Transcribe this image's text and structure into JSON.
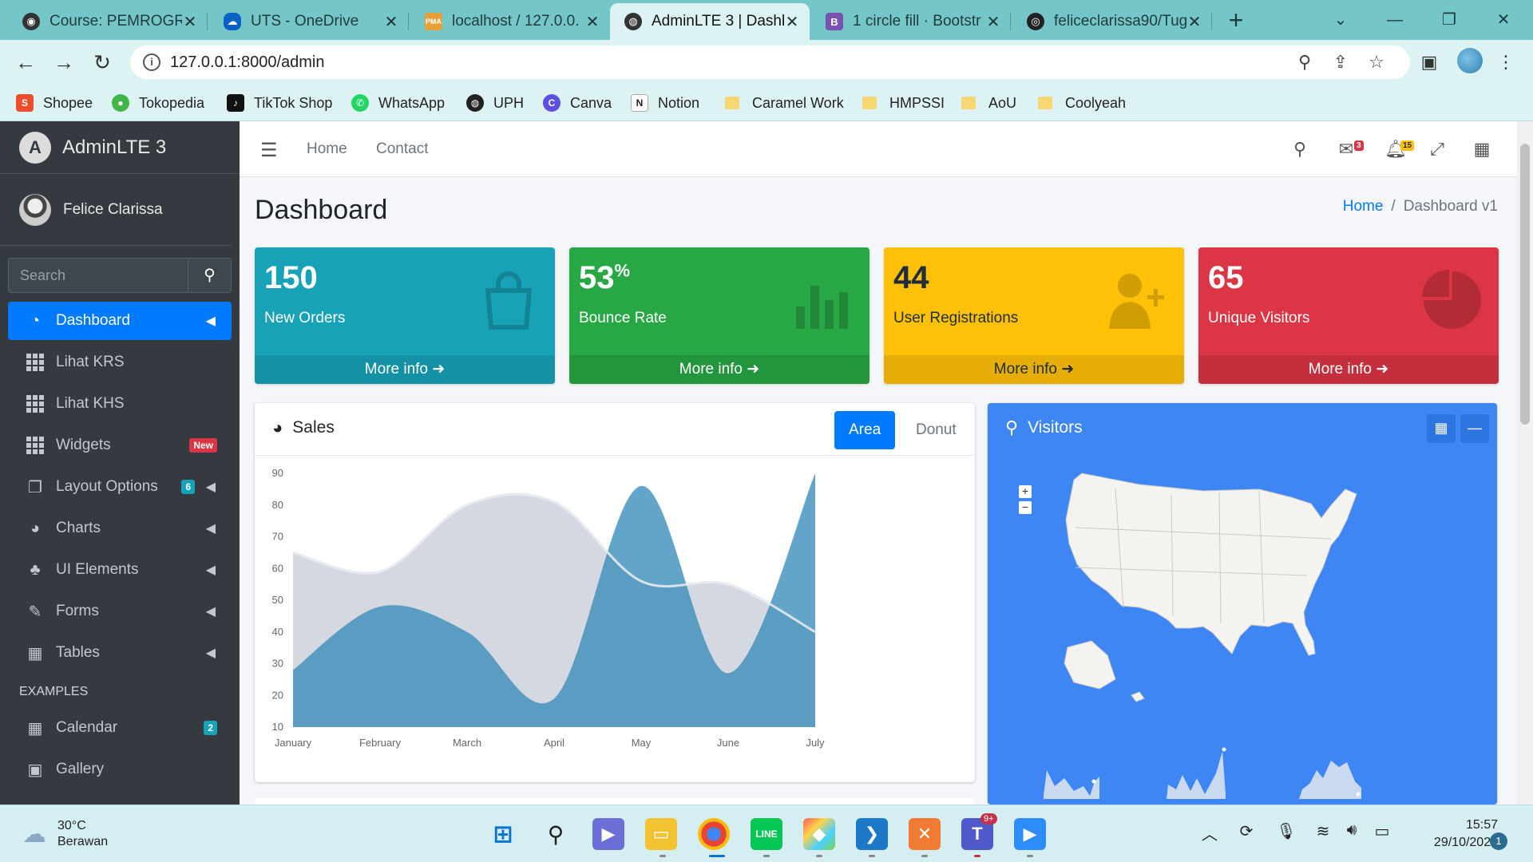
{
  "browser": {
    "tabs": [
      {
        "title": "Course: PEMROGRA",
        "icon": "moodle-icon",
        "active": false
      },
      {
        "title": "UTS - OneDrive",
        "icon": "onedrive-icon",
        "active": false
      },
      {
        "title": "localhost / 127.0.0.",
        "icon": "phpmyadmin-icon",
        "active": false
      },
      {
        "title": "AdminLTE 3 | Dashb",
        "icon": "globe-icon",
        "active": true
      },
      {
        "title": "1 circle fill · Bootstr",
        "icon": "bootstrap-icon",
        "active": false
      },
      {
        "title": "feliceclarissa90/Tug",
        "icon": "github-icon",
        "active": false
      }
    ],
    "url": "127.0.0.1:8000/admin",
    "bookmarks": [
      {
        "label": "Shopee",
        "icon": "shopee-icon"
      },
      {
        "label": "Tokopedia",
        "icon": "tokopedia-icon"
      },
      {
        "label": "TikTok Shop",
        "icon": "tiktok-icon"
      },
      {
        "label": "WhatsApp",
        "icon": "whatsapp-icon"
      },
      {
        "label": "UPH",
        "icon": "uph-icon"
      },
      {
        "label": "Canva",
        "icon": "canva-icon"
      },
      {
        "label": "Notion",
        "icon": "notion-icon"
      },
      {
        "label": "Caramel Work",
        "icon": "folder-icon"
      },
      {
        "label": "HMPSSI",
        "icon": "folder-icon"
      },
      {
        "label": "AoU",
        "icon": "folder-icon"
      },
      {
        "label": "Coolyeah",
        "icon": "folder-icon"
      }
    ]
  },
  "sidebar": {
    "brand": "AdminLTE 3",
    "user": "Felice Clarissa",
    "search_placeholder": "Search",
    "items": [
      {
        "label": "Dashboard",
        "icon": "tachometer-icon",
        "active": true,
        "arrow": true
      },
      {
        "label": "Lihat KRS",
        "icon": "grid-icon"
      },
      {
        "label": "Lihat KHS",
        "icon": "grid-icon"
      },
      {
        "label": "Widgets",
        "icon": "grid-icon",
        "badge": "New"
      },
      {
        "label": "Layout Options",
        "icon": "copy-icon",
        "badge": "6",
        "arrow": true
      },
      {
        "label": "Charts",
        "icon": "pie-chart-icon",
        "arrow": true
      },
      {
        "label": "UI Elements",
        "icon": "tree-icon",
        "arrow": true
      },
      {
        "label": "Forms",
        "icon": "edit-icon",
        "arrow": true
      },
      {
        "label": "Tables",
        "icon": "table-icon",
        "arrow": true
      }
    ],
    "section_header": "EXAMPLES",
    "examples": [
      {
        "label": "Calendar",
        "icon": "calendar-icon",
        "badge": "2"
      },
      {
        "label": "Gallery",
        "icon": "image-icon"
      }
    ]
  },
  "topnav": {
    "links": [
      "Home",
      "Contact"
    ],
    "messages_count": "3",
    "notifications_count": "15"
  },
  "page": {
    "title": "Dashboard",
    "breadcrumb": {
      "home": "Home",
      "current": "Dashboard v1"
    }
  },
  "small_boxes": [
    {
      "value": "150",
      "suffix": "",
      "label": "New Orders",
      "footer": "More info",
      "color": "#17a2b8",
      "icon": "shopping-bag-icon"
    },
    {
      "value": "53",
      "suffix": "%",
      "label": "Bounce Rate",
      "footer": "More info",
      "color": "#28a745",
      "icon": "bar-chart-icon"
    },
    {
      "value": "44",
      "suffix": "",
      "label": "User Registrations",
      "footer": "More info",
      "color": "#ffc107",
      "icon": "user-plus-icon"
    },
    {
      "value": "65",
      "suffix": "",
      "label": "Unique Visitors",
      "footer": "More info",
      "color": "#dc3545",
      "icon": "pie-chart-icon"
    }
  ],
  "sales_card": {
    "title": "Sales",
    "tabs": [
      "Area",
      "Donut"
    ],
    "active_tab": "Area"
  },
  "visitors_card": {
    "title": "Visitors"
  },
  "chart_data": {
    "type": "area",
    "categories": [
      "January",
      "February",
      "March",
      "April",
      "May",
      "June",
      "July"
    ],
    "ylim": [
      10,
      90
    ],
    "yticks": [
      10,
      20,
      30,
      40,
      50,
      60,
      70,
      80,
      90
    ],
    "series": [
      {
        "values": [
          65,
          59,
          80,
          81,
          56,
          55,
          40
        ],
        "color": "#d2d6de"
      },
      {
        "values": [
          28,
          48,
          40,
          19,
          86,
          27,
          90
        ],
        "color": "#3c8dbc"
      }
    ]
  },
  "taskbar": {
    "weather_temp": "30°C",
    "weather_desc": "Berawan",
    "time": "15:57",
    "date": "29/10/2022",
    "notifications": "1",
    "teams_badge": "9+"
  }
}
